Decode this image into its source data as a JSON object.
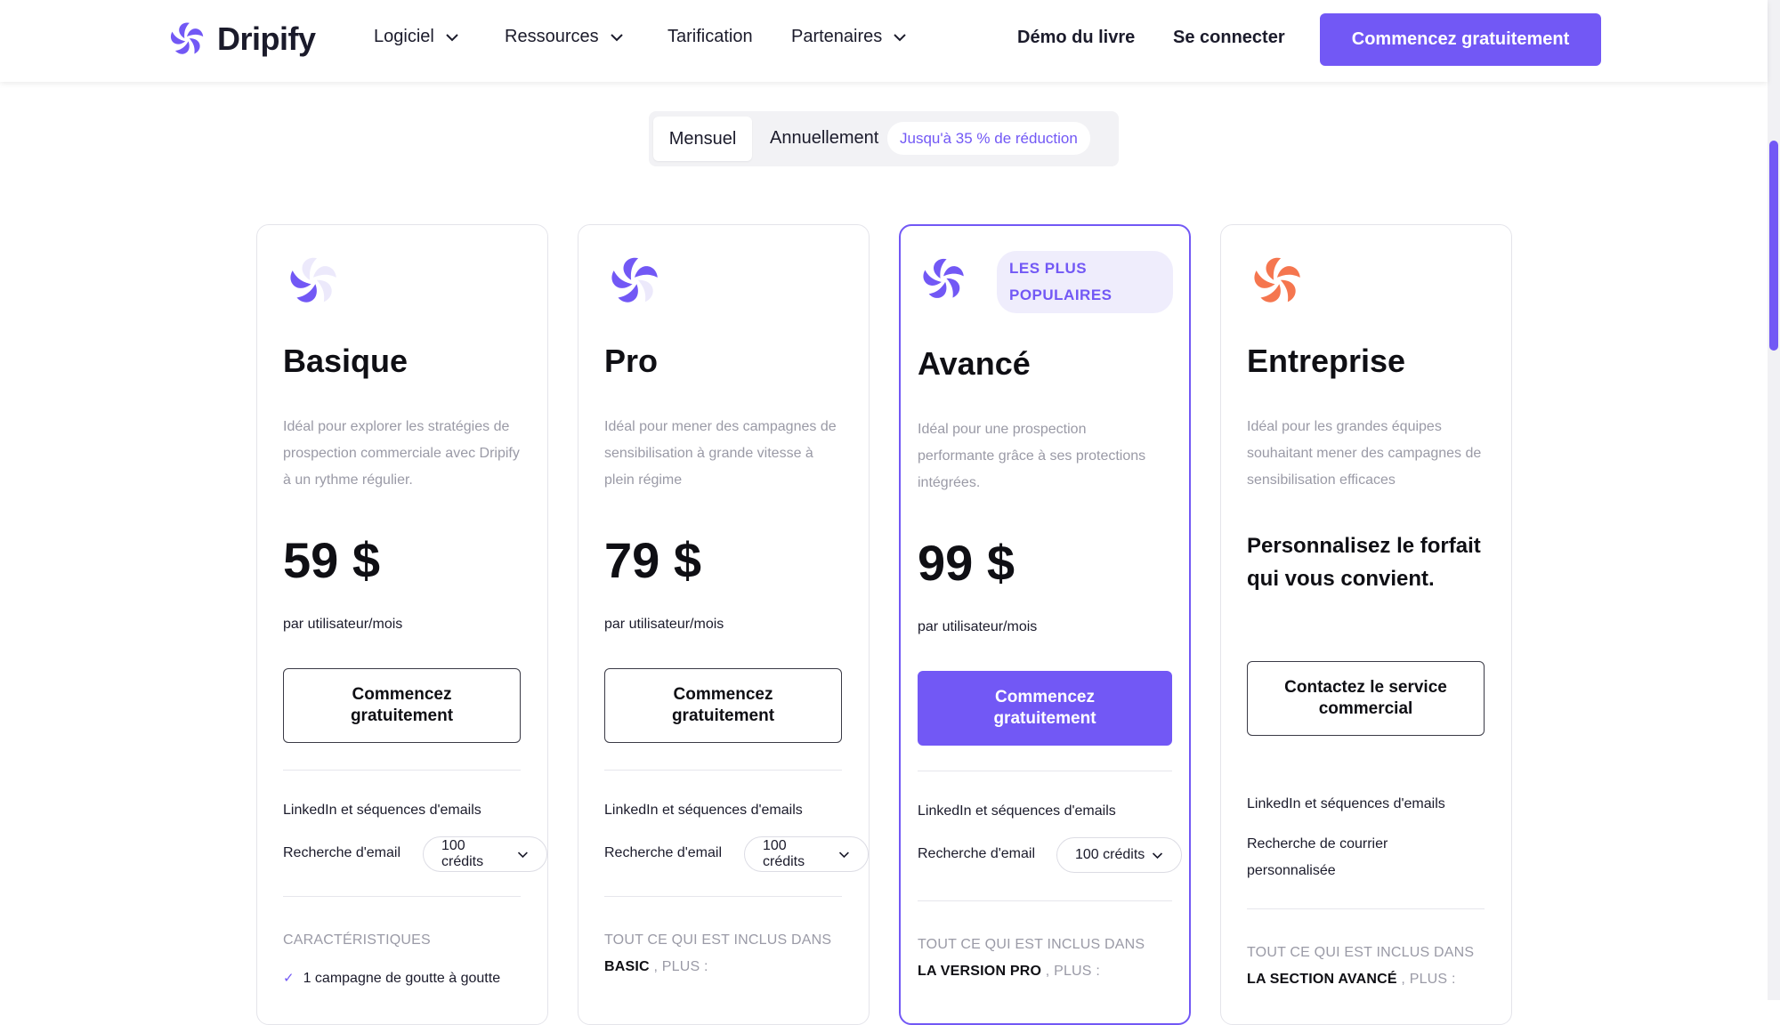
{
  "header": {
    "brand": "Dripify",
    "nav": [
      {
        "label": "Logiciel"
      },
      {
        "label": "Ressources"
      },
      {
        "label": "Tarification"
      },
      {
        "label": "Partenaires"
      }
    ],
    "demo_label": "Démo du livre",
    "login_label": "Se connecter",
    "cta_label": "Commencez gratuitement"
  },
  "billing_toggle": {
    "monthly": "Mensuel",
    "yearly": "Annuellement",
    "discount_badge": "Jusqu'à 35 % de réduction",
    "selected": "Mensuel"
  },
  "plans": [
    {
      "name": "Basique",
      "description": "Idéal pour explorer les stratégies de prospection commerciale avec Dripify à un rythme régulier.",
      "price": "59 $",
      "period": "par utilisateur/mois",
      "button": "Commencez gratuitement",
      "feature_1": "LinkedIn et séquences d'emails",
      "feature_2": "Recherche d'email",
      "credits": "100 crédits",
      "section_title": "CARACTÉRISTIQUES",
      "first_item": "1 campagne de goutte à goutte"
    },
    {
      "name": "Pro",
      "description": "Idéal pour mener des campagnes de sensibilisation à grande vitesse à plein régime",
      "price": "79 $",
      "period": "par utilisateur/mois",
      "button": "Commencez gratuitement",
      "feature_1": "LinkedIn et séquences d'emails",
      "feature_2": "Recherche d'email",
      "credits": "100 crédits",
      "section_prefix": "TOUT CE QUI EST INCLUS DANS",
      "section_bold": "BASIC",
      "section_suffix": ", PLUS :"
    },
    {
      "name": "Avancé",
      "badge": "LES PLUS POPULAIRES",
      "description": "Idéal pour une prospection performante grâce à ses protections intégrées.",
      "price": "99 $",
      "period": "par utilisateur/mois",
      "button": "Commencez gratuitement",
      "feature_1": "LinkedIn et séquences d'emails",
      "feature_2": "Recherche d'email",
      "credits": "100 crédits",
      "section_prefix": "TOUT CE QUI EST INCLUS DANS",
      "section_bold": "LA VERSION PRO",
      "section_suffix": ", PLUS :"
    },
    {
      "name": "Entreprise",
      "description": "Idéal pour les grandes équipes souhaitant mener des campagnes de sensibilisation efficaces",
      "custom_text": "Personnalisez le forfait qui vous convient.",
      "button": "Contactez le service commercial",
      "feature_1": "LinkedIn et séquences d'emails",
      "feature_2": "Recherche de courrier personnalisée",
      "section_prefix": "TOUT CE QUI EST INCLUS DANS",
      "section_bold": "LA SECTION AVANCÉ",
      "section_suffix": ", PLUS :"
    }
  ],
  "colors": {
    "accent": "#7258f5",
    "enterprise_accent": "#f5764f",
    "muted_text": "#9a9aa6"
  },
  "icons": [
    "dripify-logo-icon",
    "chevron-down-icon",
    "plan-icon",
    "check-icon"
  ]
}
